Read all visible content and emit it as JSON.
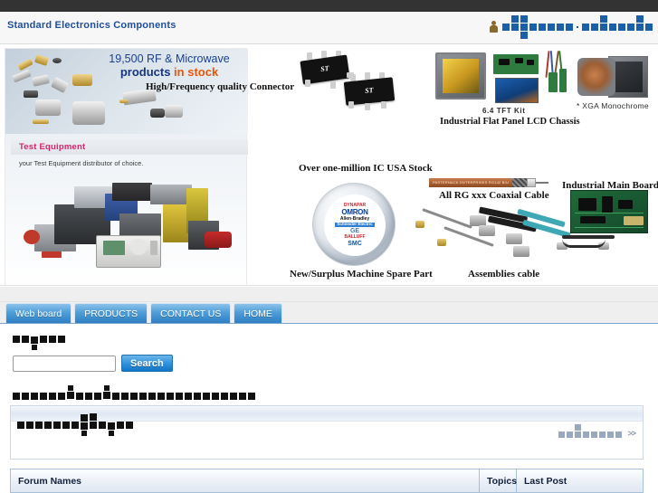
{
  "topbar": {
    "present": true,
    "color": "#333333"
  },
  "header": {
    "site_title": "Standard Electronics Components",
    "title_color": "#1f4e9c",
    "user_icon": "user-icon",
    "right_text_tofu": "■■■■■■■■ . ■■■■■■■■",
    "right_text_note": "unrenderable glyphs (blue blocks)"
  },
  "banner": {
    "promo": {
      "line1": "19,500 RF & Microwave",
      "line2_a": "products ",
      "line2_b": "in stock",
      "subtitle": "High/Frequency  quality Connector",
      "test_equipment_title": "Test Equipment",
      "test_equipment_sub": "your Test Equipment distributor of choice."
    },
    "captions": {
      "ic_stock": "Over one-million IC USA Stock",
      "spare_part": "New/Surplus Machine Spare Part",
      "tft_kit": "6.4 TFT Kit",
      "lcd_chassis": "Industrial Flat Panel LCD Chassis",
      "xga_mono": "* XGA Monochrome",
      "coaxial": "All RG xxx Coaxial Cable",
      "assemblies": "Assemblies cable",
      "mainboard": "Industrial Main Board"
    },
    "chip_logo": "ST",
    "coax_print": "PASTERNACK ENTERPRISES RG142 B/U",
    "logo_brands": [
      "DYNAPAR",
      "OMRON",
      "Allen-Bradley",
      "Schneider Electric",
      "GE",
      "BALLUFF",
      "SMC"
    ]
  },
  "nav": {
    "tabs": [
      {
        "label": "Web board",
        "active": true
      },
      {
        "label": "PRODUCTS",
        "active": false
      },
      {
        "label": "CONTACT US",
        "active": false
      },
      {
        "label": "HOME",
        "active": false
      }
    ]
  },
  "search": {
    "heading_tofu_count": 6,
    "heading_tofu_sub": 1,
    "input_value": "",
    "placeholder": "",
    "button_label": "Search"
  },
  "description_line": {
    "tofu_count": 27,
    "above_tofu_count": 2
  },
  "panel": {
    "header_tofu_count": 13,
    "header_above_tofu": 2,
    "header_below_tofu": 2,
    "right_tofu_count": 8,
    "right_above_tofu": 2,
    "more_label": ">>"
  },
  "forum_table": {
    "columns": [
      "Forum Names",
      "Topics",
      "Last Post"
    ],
    "rows": []
  },
  "colors": {
    "accent_blue": "#2f7fc4",
    "header_title": "#1f4e9c",
    "tofu_blue": "#1a5fa8",
    "tofu_black": "#111111",
    "tofu_gray": "#9aa8bd",
    "topbar": "#333333",
    "promo_orange": "#e2590e",
    "test_equipment_pink": "#d3246b"
  }
}
